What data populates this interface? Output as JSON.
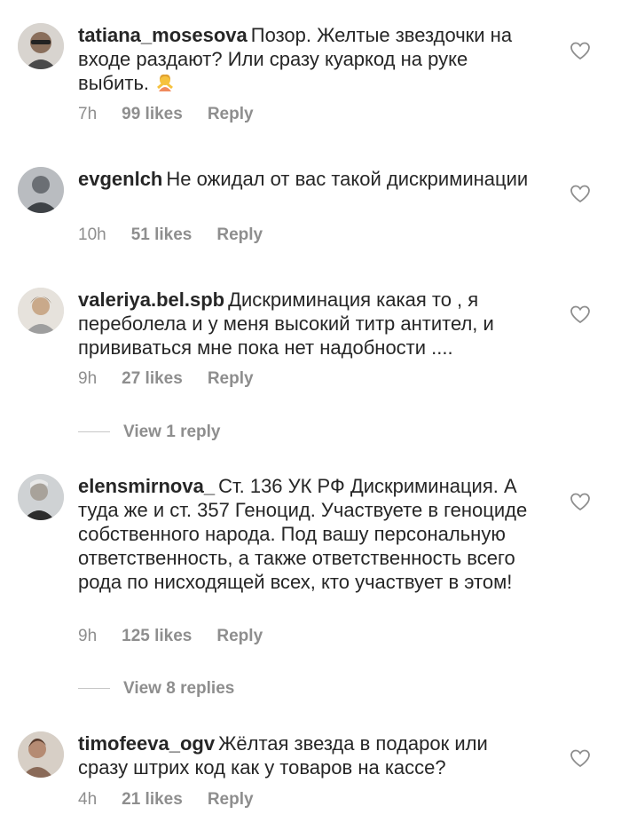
{
  "comments": [
    {
      "username": "tatiana_mosesova",
      "text": "Позор. Желтые звездочки на входе раздают? Или сразу куаркод на руке выбить.",
      "emoji": "woman-gesturing-no-emoji",
      "time": "7h",
      "likes": "99 likes",
      "reply": "Reply"
    },
    {
      "username": "evgenlch",
      "text": "Не ожидал от вас такой дискриминации",
      "time": "10h",
      "likes": "51 likes",
      "reply": "Reply"
    },
    {
      "username": "valeriya.bel.spb",
      "text": "Дискриминация какая то , я переболела и у меня высокий титр антител, и прививаться мне пока нет надобности ....",
      "time": "9h",
      "likes": "27 likes",
      "reply": "Reply",
      "view_replies": "View 1 reply"
    },
    {
      "username": "elensmirnova_",
      "text": "Ст. 136 УК РФ Дискриминация. А туда же и ст. 357 Геноцид. Участвуете в геноциде собственного народа. Под вашу персональную ответственность, а также ответственность всего рода по нисходящей всех, кто участвует в этом!",
      "time": "9h",
      "likes": "125 likes",
      "reply": "Reply",
      "view_replies": "View 8 replies"
    },
    {
      "username": "timofeeva_ogv",
      "text": "Жёлтая звезда в подарок или сразу штрих код как у товаров на кассе?",
      "time": "4h",
      "likes": "21 likes",
      "reply": "Reply"
    }
  ],
  "colors": {
    "text": "#262626",
    "meta": "#8e8e8e",
    "divider": "#c7c7c7"
  },
  "icons": {
    "like": "heart-outline-icon"
  }
}
